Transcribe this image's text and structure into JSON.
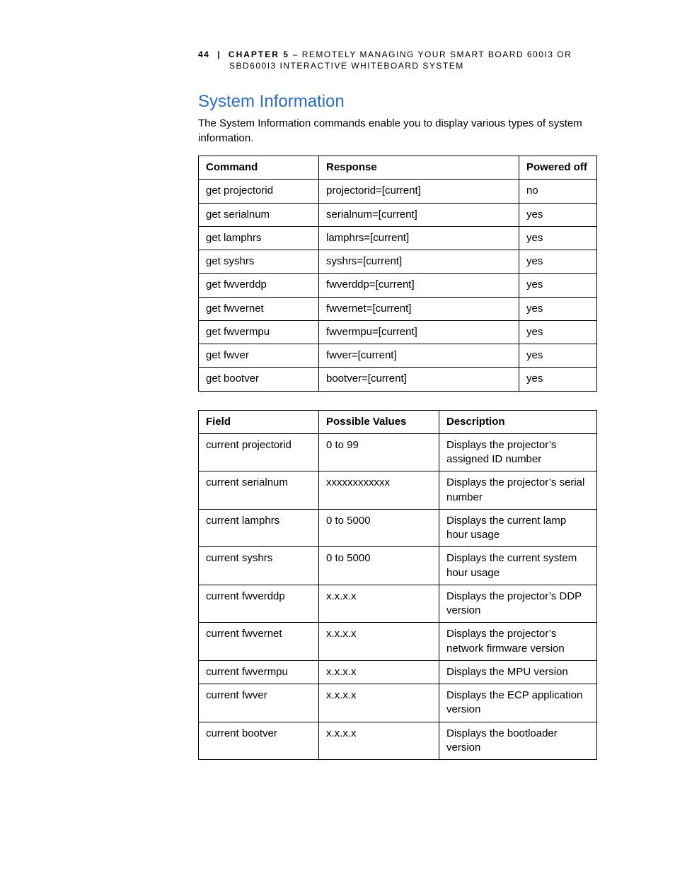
{
  "header": {
    "page_number": "44",
    "separator": "|",
    "chapter_label": "CHAPTER 5",
    "dash": " – ",
    "title_line1": "REMOTELY MANAGING YOUR SMART BOARD 600I3 OR",
    "title_line2": "SBD600I3 INTERACTIVE WHITEBOARD SYSTEM"
  },
  "section": {
    "title": "System Information",
    "intro": "The System Information commands enable you to display various types of system information."
  },
  "table1": {
    "headers": {
      "c1": "Command",
      "c2": "Response",
      "c3": "Powered off"
    },
    "rows": [
      {
        "c1": "get projectorid",
        "c2": "projectorid=[current]",
        "c3": "no"
      },
      {
        "c1": "get serialnum",
        "c2": "serialnum=[current]",
        "c3": "yes"
      },
      {
        "c1": "get lamphrs",
        "c2": "lamphrs=[current]",
        "c3": "yes"
      },
      {
        "c1": "get syshrs",
        "c2": "syshrs=[current]",
        "c3": "yes"
      },
      {
        "c1": "get fwverddp",
        "c2": "fwverddp=[current]",
        "c3": "yes"
      },
      {
        "c1": "get fwvernet",
        "c2": "fwvernet=[current]",
        "c3": "yes"
      },
      {
        "c1": "get fwvermpu",
        "c2": "fwvermpu=[current]",
        "c3": "yes"
      },
      {
        "c1": "get fwver",
        "c2": "fwver=[current]",
        "c3": "yes"
      },
      {
        "c1": "get bootver",
        "c2": "bootver=[current]",
        "c3": "yes"
      }
    ]
  },
  "table2": {
    "headers": {
      "c1": "Field",
      "c2": "Possible Values",
      "c3": "Description"
    },
    "rows": [
      {
        "c1": "current projectorid",
        "c2": "0 to 99",
        "c3": "Displays the projector’s assigned ID number"
      },
      {
        "c1": "current serialnum",
        "c2": "xxxxxxxxxxxx",
        "c3": "Displays the projector’s serial number"
      },
      {
        "c1": "current lamphrs",
        "c2": "0 to 5000",
        "c3": "Displays the current lamp hour usage"
      },
      {
        "c1": "current syshrs",
        "c2": "0 to 5000",
        "c3": "Displays the current system hour usage"
      },
      {
        "c1": "current fwverddp",
        "c2": "x.x.x.x",
        "c3": "Displays the projector’s DDP version"
      },
      {
        "c1": "current fwvernet",
        "c2": "x.x.x.x",
        "c3": "Displays the projector’s network firmware version"
      },
      {
        "c1": "current fwvermpu",
        "c2": "x.x.x.x",
        "c3": "Displays the MPU version"
      },
      {
        "c1": "current fwver",
        "c2": "x.x.x.x",
        "c3": "Displays the ECP application version"
      },
      {
        "c1": "current bootver",
        "c2": "x.x.x.x",
        "c3": "Displays the bootloader version"
      }
    ]
  }
}
